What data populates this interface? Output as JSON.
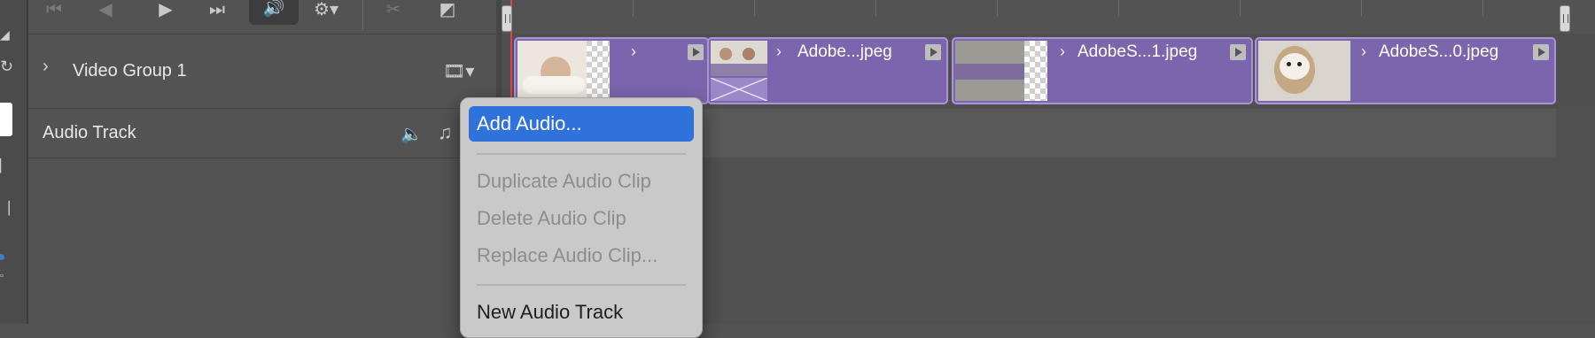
{
  "tracks": {
    "video_group_label": "Video Group 1",
    "audio_track_label": "Audio Track"
  },
  "clips": [
    {
      "name": ""
    },
    {
      "name": "Adobe...jpeg"
    },
    {
      "name": "AdobeS...1.jpeg"
    },
    {
      "name": "AdobeS...0.jpeg"
    }
  ],
  "context_menu": {
    "add_audio": "Add Audio...",
    "duplicate_audio_clip": "Duplicate Audio Clip",
    "delete_audio_clip": "Delete Audio Clip",
    "replace_audio_clip": "Replace Audio Clip...",
    "new_audio_track": "New Audio Track"
  },
  "colors": {
    "clip_fill": "#7b65ad",
    "menu_highlight": "#2f72dc",
    "playhead": "#e0434b"
  },
  "icons": [
    "go-to-first-frame-icon",
    "previous-frame-icon",
    "play-icon",
    "next-frame-icon",
    "audio-speaker-icon",
    "gear-icon",
    "scissors-icon",
    "transition-icon",
    "chevron-right-icon",
    "film-strip-icon",
    "music-note-icon"
  ]
}
